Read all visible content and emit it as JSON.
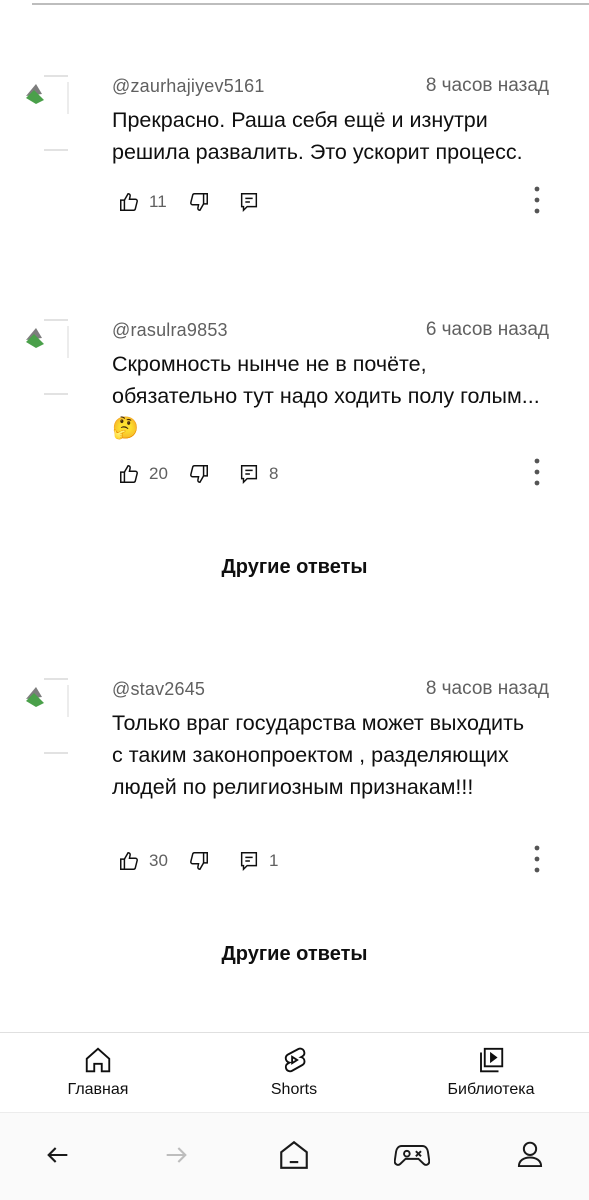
{
  "comments": [
    {
      "handle": "@zaurhajiyev5161",
      "time": "8 часов назад",
      "text": "Прекрасно. Раша себя ещё и изнутри решила развалить. Это ускорит процесс.",
      "likes": "11",
      "replies": ""
    },
    {
      "handle": "@rasulra9853",
      "time": "6 часов назад",
      "text": "Скромность нынче не в почёте, обязательно тут надо ходить полу голым...🤔",
      "likes": "20",
      "replies": "8"
    },
    {
      "handle": "@stav2645",
      "time": "8 часов назад",
      "text": "Только враг государства может выходить с таким законопроектом , разделяющих людей по религиозным признакам!!!",
      "likes": "30",
      "replies": "1"
    }
  ],
  "other_replies_label": "Другие ответы",
  "bottom_nav": {
    "home": "Главная",
    "shorts": "Shorts",
    "library": "Библиотека"
  },
  "icons": {
    "like": "thumbs-up-icon",
    "dislike": "thumbs-down-icon",
    "reply": "reply-comment-icon",
    "more": "more-vertical-icon",
    "home": "home-icon",
    "shorts": "shorts-icon",
    "library": "library-icon",
    "back": "back-arrow-icon",
    "forward": "forward-arrow-icon",
    "system_home": "system-home-icon",
    "game": "gamepad-icon",
    "profile": "profile-icon"
  }
}
